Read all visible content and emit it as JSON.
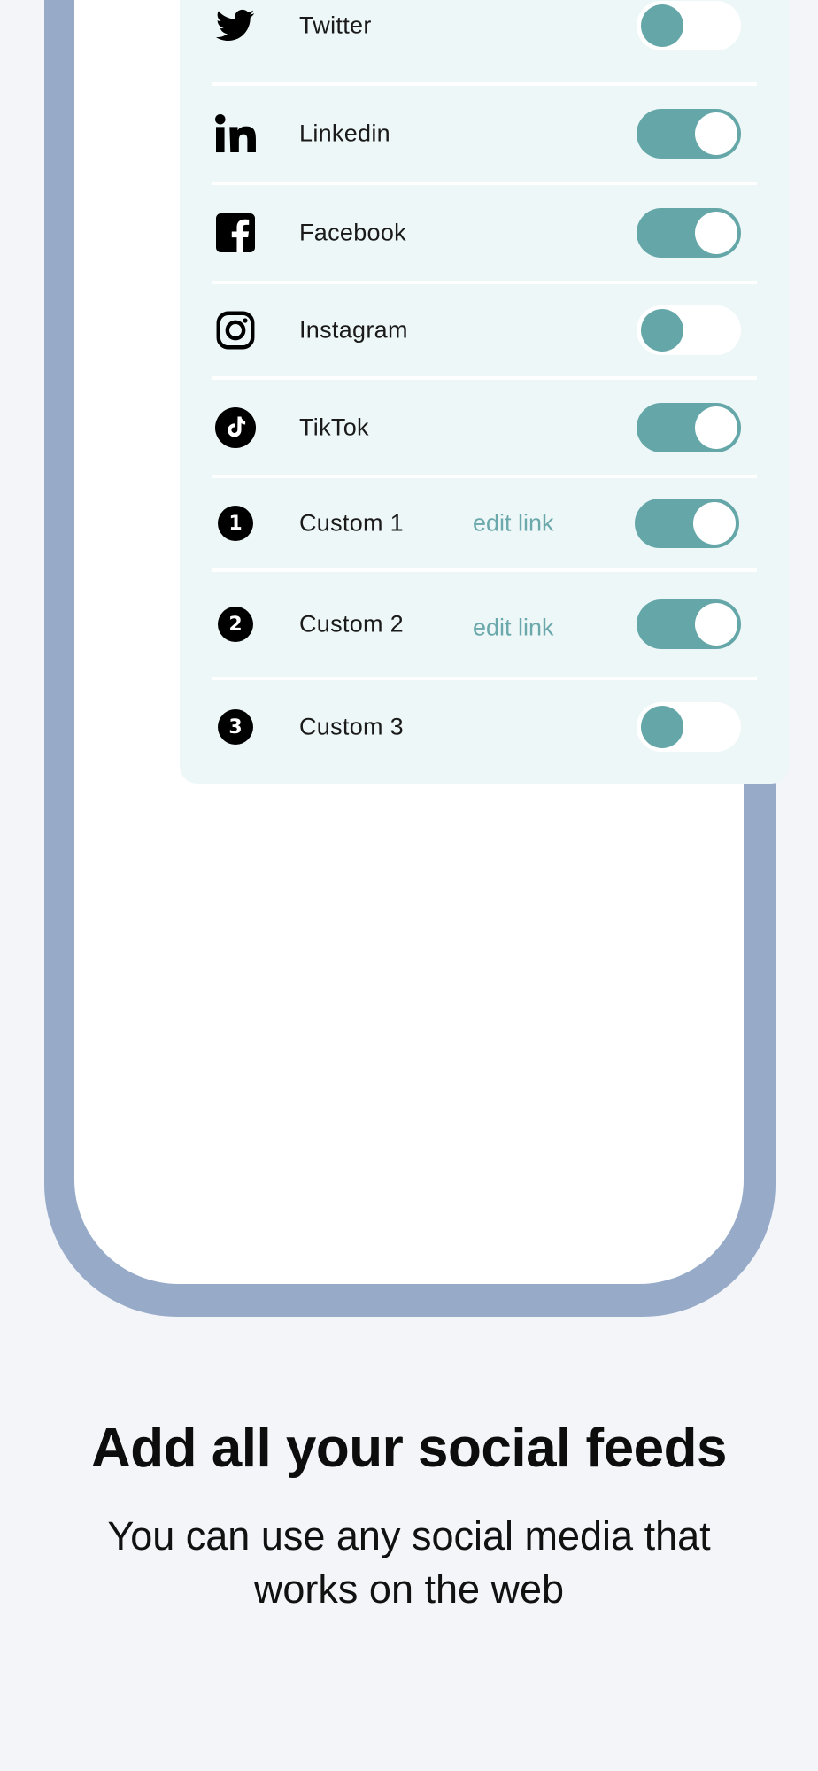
{
  "settings": {
    "rows": [
      {
        "label": "Twitter",
        "icon": "twitter-icon",
        "enabled": false
      },
      {
        "label": "Linkedin",
        "icon": "linkedin-icon",
        "enabled": true
      },
      {
        "label": "Facebook",
        "icon": "facebook-icon",
        "enabled": true
      },
      {
        "label": "Instagram",
        "icon": "instagram-icon",
        "enabled": false
      },
      {
        "label": "TikTok",
        "icon": "tiktok-icon",
        "enabled": true
      },
      {
        "label": "Custom 1",
        "icon": "number-1-icon",
        "badge": "1",
        "edit_link": "edit link",
        "enabled": true
      },
      {
        "label": "Custom 2",
        "icon": "number-2-icon",
        "badge": "2",
        "edit_link": "edit link",
        "enabled": true
      },
      {
        "label": "Custom 3",
        "icon": "number-3-icon",
        "badge": "3",
        "enabled": false
      }
    ]
  },
  "promo": {
    "headline": "Add all your social feeds",
    "subline": "You can use any social media that works on the web"
  },
  "colors": {
    "background": "#f3f5f9",
    "phone_frame": "#97abc9",
    "card": "#eef7f7",
    "accent": "#65a7a8",
    "link": "#6aa8ab"
  }
}
